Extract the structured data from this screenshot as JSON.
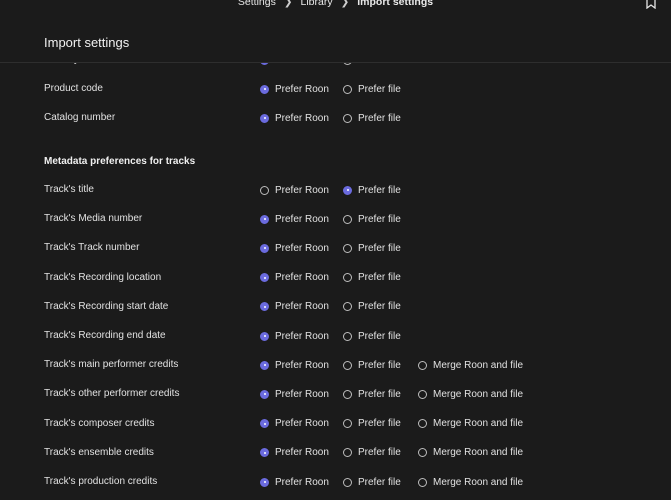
{
  "breadcrumb": [
    "Settings",
    "Library",
    "Import settings"
  ],
  "title": "Import settings",
  "options": {
    "roon": "Prefer Roon",
    "file": "Prefer file",
    "merge": "Merge Roon and file"
  },
  "album_rows": [
    {
      "label": "Country",
      "selected": "roon",
      "merge": false
    },
    {
      "label": "Product code",
      "selected": "roon",
      "merge": false
    },
    {
      "label": "Catalog number",
      "selected": "roon",
      "merge": false
    }
  ],
  "tracks_section_title": "Metadata preferences for tracks",
  "track_rows": [
    {
      "label": "Track's title",
      "selected": "file",
      "merge": false
    },
    {
      "label": "Track's Media number",
      "selected": "roon",
      "merge": false
    },
    {
      "label": "Track's Track number",
      "selected": "roon",
      "merge": false
    },
    {
      "label": "Track's Recording location",
      "selected": "roon",
      "merge": false
    },
    {
      "label": "Track's Recording start date",
      "selected": "roon",
      "merge": false
    },
    {
      "label": "Track's Recording end date",
      "selected": "roon",
      "merge": false
    },
    {
      "label": "Track's main performer credits",
      "selected": "roon",
      "merge": true
    },
    {
      "label": "Track's other performer credits",
      "selected": "roon",
      "merge": true
    },
    {
      "label": "Track's composer credits",
      "selected": "roon",
      "merge": true
    },
    {
      "label": "Track's ensemble credits",
      "selected": "roon",
      "merge": true
    },
    {
      "label": "Track's production credits",
      "selected": "roon",
      "merge": true
    }
  ],
  "colors": {
    "accent": "#6b6bde",
    "background": "#1b1b1b"
  }
}
